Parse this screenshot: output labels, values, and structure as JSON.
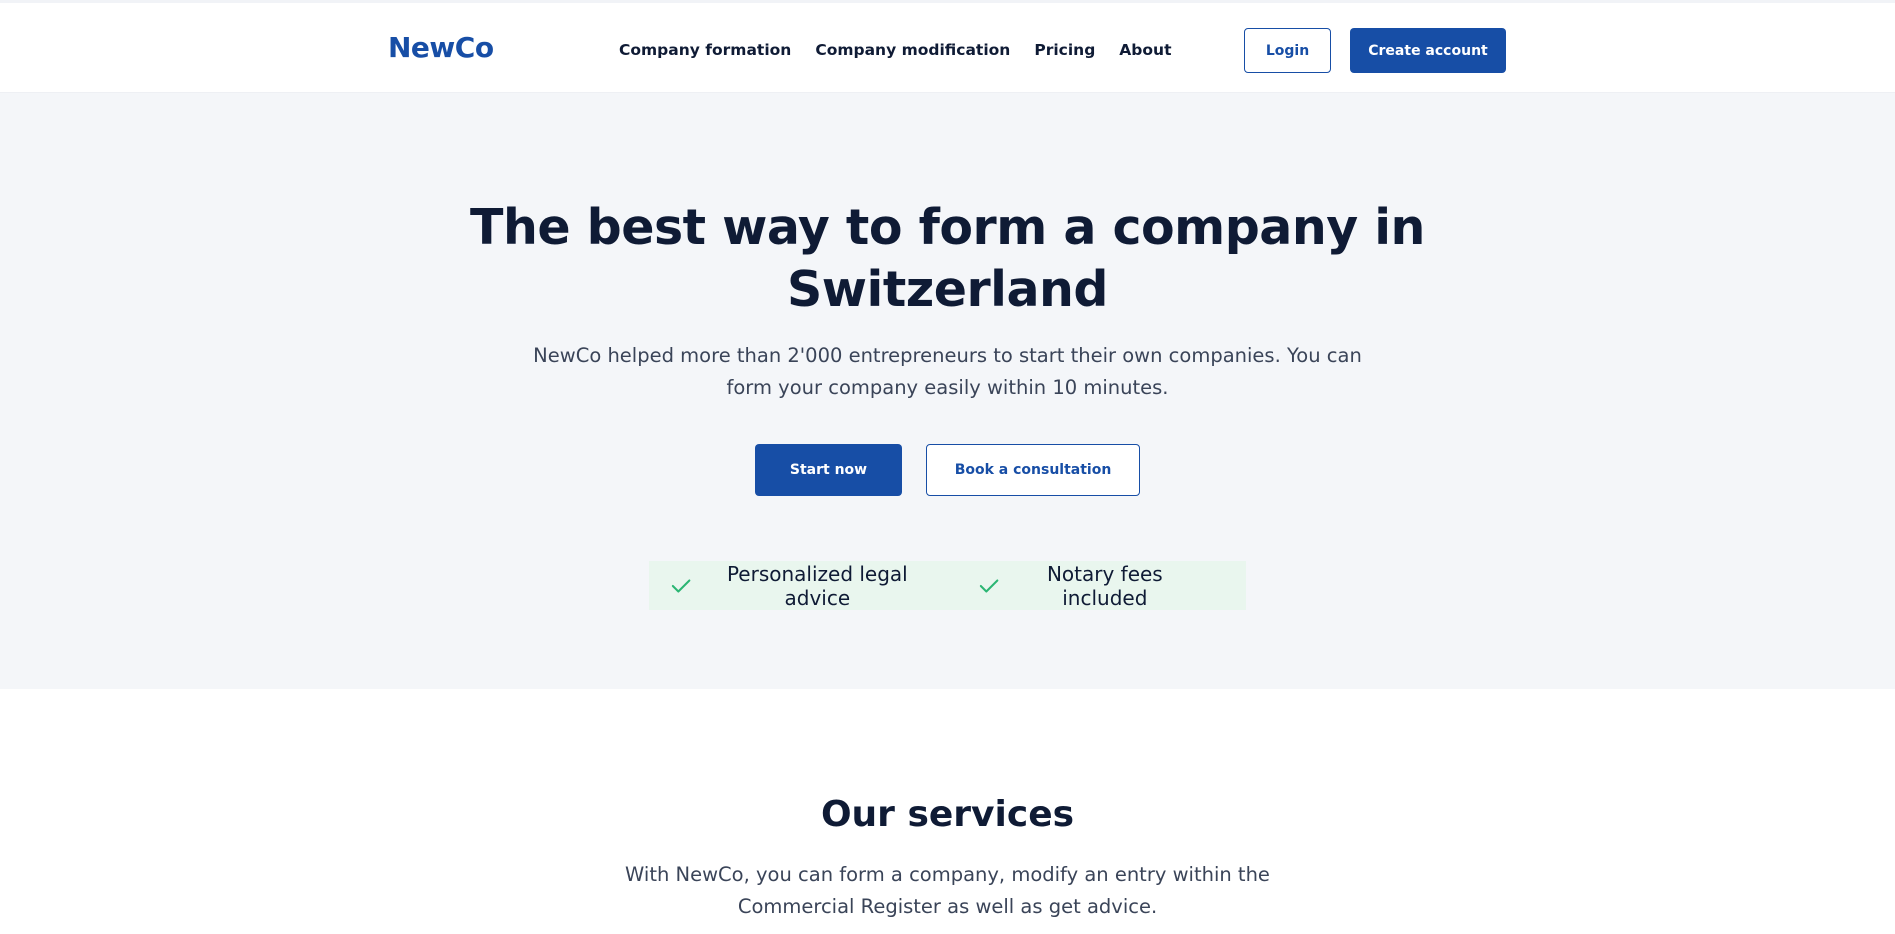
{
  "header": {
    "logo": "NewCo",
    "nav": [
      {
        "label": "Company formation"
      },
      {
        "label": "Company modification"
      },
      {
        "label": "Pricing"
      },
      {
        "label": "About"
      }
    ],
    "login_label": "Login",
    "create_account_label": "Create account"
  },
  "hero": {
    "title_line1": "The best way to form a company in",
    "title_line2": "Switzerland",
    "subtitle_line1": "NewCo helped more than 2'000 entrepreneurs to start their own companies. You can",
    "subtitle_line2": "form your company easily within 10 minutes.",
    "start_label": "Start now",
    "consult_label": "Book a consultation",
    "features": [
      {
        "label": "Personalized legal advice",
        "icon": "check-icon"
      },
      {
        "label": "Notary fees included",
        "icon": "check-icon"
      }
    ]
  },
  "services": {
    "title": "Our services",
    "description_line1": "With NewCo, you can form a company, modify an entry within the",
    "description_line2": "Commercial Register as well as get advice."
  },
  "colors": {
    "brand": "#174ea6",
    "text": "#0f1b35",
    "hero_bg": "#f4f6f9",
    "feature_bg": "#e9f6ee",
    "check": "#2bb673"
  }
}
